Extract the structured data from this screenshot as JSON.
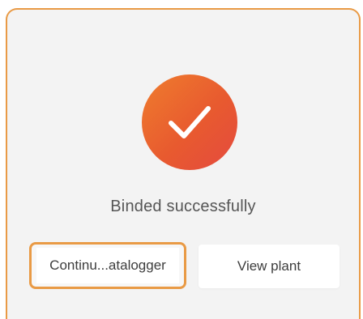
{
  "dialog": {
    "icon": "checkmark-icon",
    "message": "Binded successfully",
    "buttons": {
      "continue_label": "Continu...atalogger",
      "view_plant_label": "View plant"
    }
  },
  "colors": {
    "accent": "#e99a45",
    "badge_start": "#ef7d2e",
    "badge_end": "#e44a3f",
    "background": "#f3f3f3"
  }
}
